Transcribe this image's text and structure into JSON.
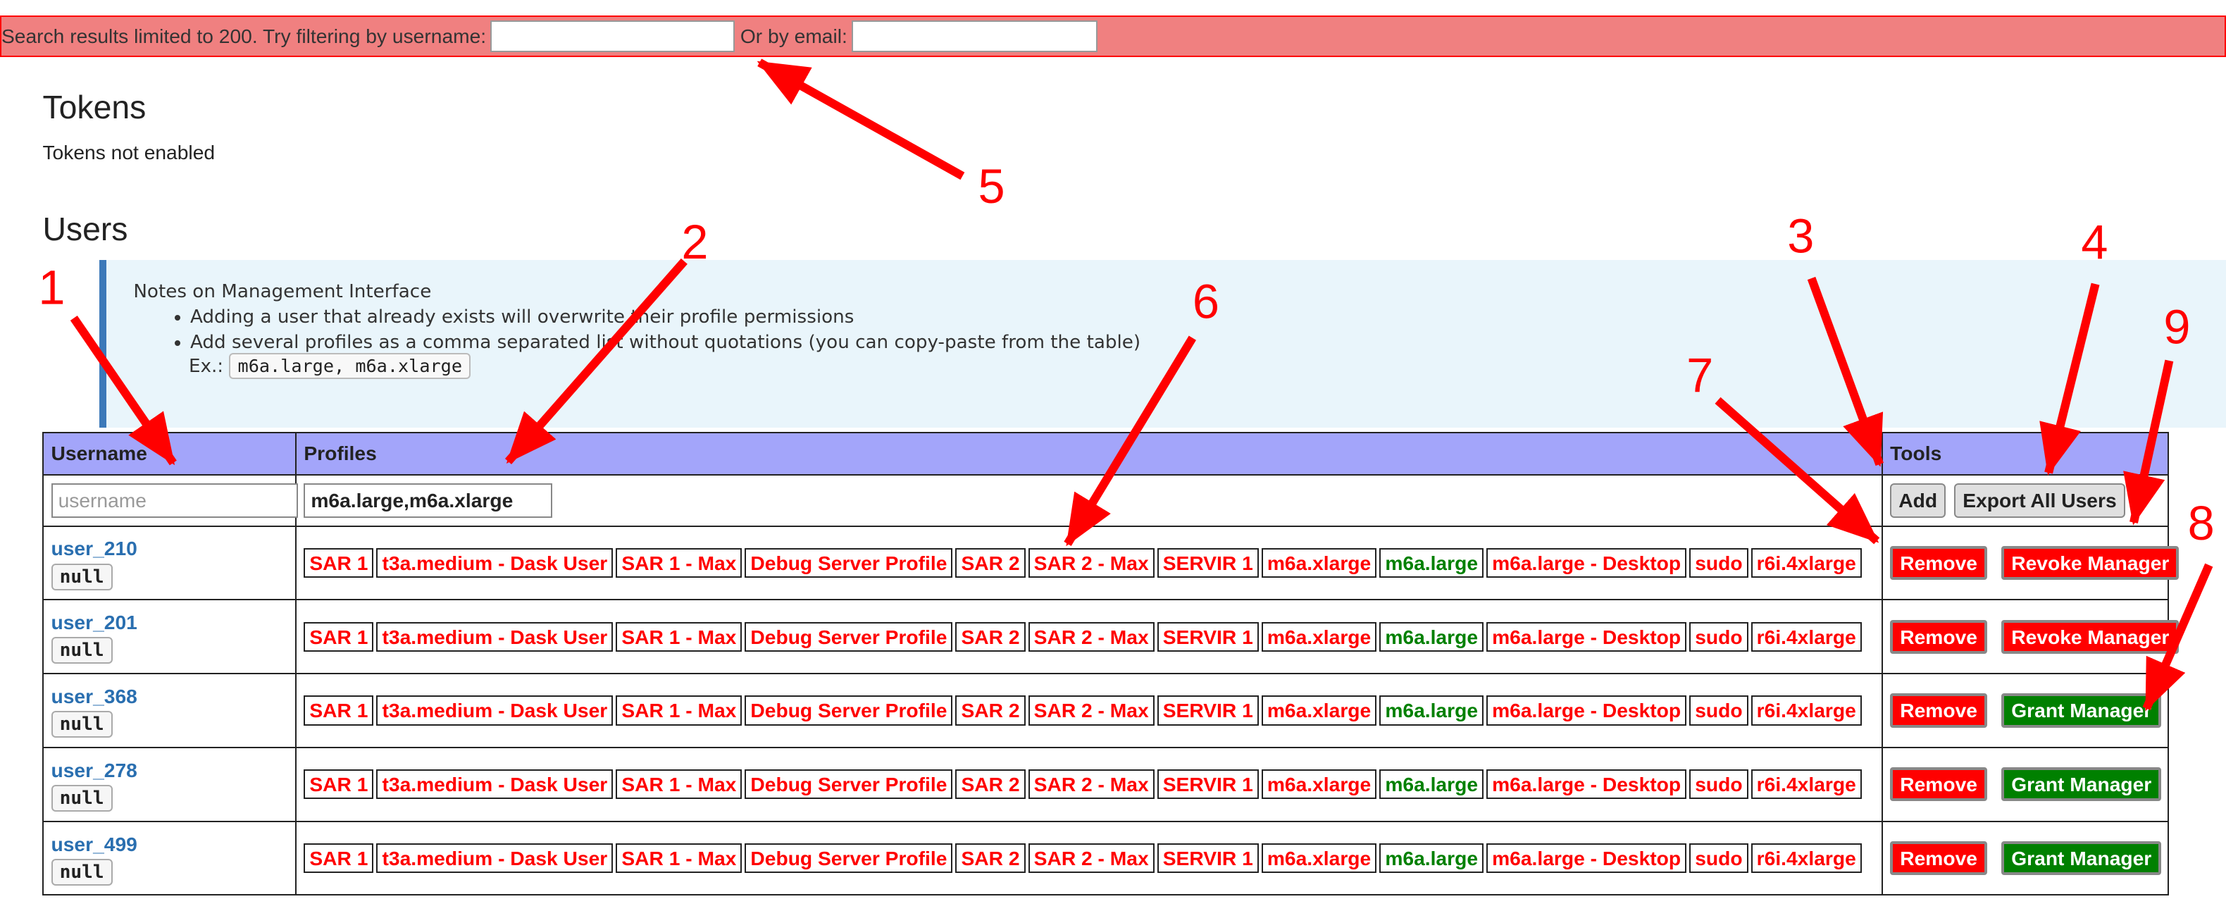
{
  "banner": {
    "text_prefix": "Search results limited to 200. Try filtering by username:",
    "text_email": "Or by email:",
    "username_value": "",
    "email_value": ""
  },
  "tokens": {
    "title": "Tokens",
    "status": "Tokens not enabled"
  },
  "users": {
    "title": "Users",
    "notes": {
      "heading": "Notes on Management Interface",
      "items": [
        "Adding a user that already exists will overwrite their profile permissions",
        "Add several profiles as a comma separated list without quotations (you can copy-paste from the table)"
      ],
      "example_label": "Ex.:",
      "example_code": "m6a.large, m6a.xlarge"
    },
    "table": {
      "headers": [
        "Username",
        "Profiles",
        "Tools"
      ],
      "new_row": {
        "username_placeholder": "username",
        "username_value": "",
        "profiles_value": "m6a.large,m6a.xlarge",
        "add_label": "Add",
        "export_label": "Export All Users"
      },
      "remove_label": "Remove",
      "rows": [
        {
          "username": "user_210",
          "badge": "null",
          "manager_label": "Revoke Manager",
          "profiles": [
            "SAR 1",
            "t3a.medium - Dask User",
            "SAR 1 - Max",
            "Debug Server Profile",
            "SAR 2",
            "SAR 2 - Max",
            "SERVIR 1",
            "m6a.xlarge",
            "m6a.large",
            "m6a.large - Desktop",
            "sudo",
            "r6i.4xlarge"
          ]
        },
        {
          "username": "user_201",
          "badge": "null",
          "manager_label": "Revoke Manager",
          "profiles": [
            "SAR 1",
            "t3a.medium - Dask User",
            "SAR 1 - Max",
            "Debug Server Profile",
            "SAR 2",
            "SAR 2 - Max",
            "SERVIR 1",
            "m6a.xlarge",
            "m6a.large",
            "m6a.large - Desktop",
            "sudo",
            "r6i.4xlarge"
          ]
        },
        {
          "username": "user_368",
          "badge": "null",
          "manager_label": "Grant Manager",
          "profiles": [
            "SAR 1",
            "t3a.medium - Dask User",
            "SAR 1 - Max",
            "Debug Server Profile",
            "SAR 2",
            "SAR 2 - Max",
            "SERVIR 1",
            "m6a.xlarge",
            "m6a.large",
            "m6a.large - Desktop",
            "sudo",
            "r6i.4xlarge"
          ]
        },
        {
          "username": "user_278",
          "badge": "null",
          "manager_label": "Grant Manager",
          "profiles": [
            "SAR 1",
            "t3a.medium - Dask User",
            "SAR 1 - Max",
            "Debug Server Profile",
            "SAR 2",
            "SAR 2 - Max",
            "SERVIR 1",
            "m6a.xlarge",
            "m6a.large",
            "m6a.large - Desktop",
            "sudo",
            "r6i.4xlarge"
          ]
        },
        {
          "username": "user_499",
          "badge": "null",
          "manager_label": "Grant Manager",
          "profiles": [
            "SAR 1",
            "t3a.medium - Dask User",
            "SAR 1 - Max",
            "Debug Server Profile",
            "SAR 2",
            "SAR 2 - Max",
            "SERVIR 1",
            "m6a.xlarge",
            "m6a.large",
            "m6a.large - Desktop",
            "sudo",
            "r6i.4xlarge"
          ]
        }
      ],
      "active_profile": "m6a.large"
    }
  },
  "annotations": [
    "1",
    "2",
    "3",
    "4",
    "5",
    "6",
    "7",
    "8",
    "9"
  ],
  "colors": {
    "banner_bg": "#f08080",
    "header_bg": "#a3a5fa",
    "notes_bg": "#e9f5fb",
    "notes_border": "#3c79b9",
    "profile_disabled": "#ff0000",
    "profile_enabled": "#008000",
    "remove_button": "#ff0000",
    "revoke_button": "#ff0000",
    "grant_button": "#008000",
    "annotation": "#ff0000"
  }
}
